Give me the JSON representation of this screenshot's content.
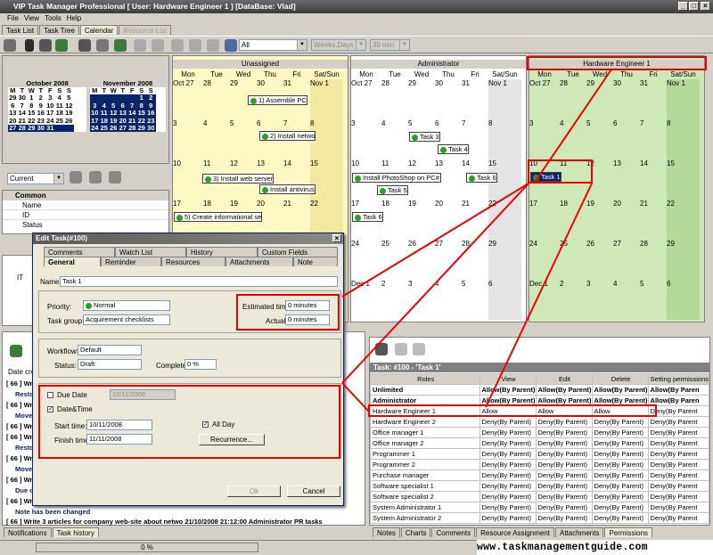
{
  "window": {
    "title": "VIP Task Manager Professional [ User: Hardware Engineer 1 ] [DataBase: Vlad]"
  },
  "menu": [
    "File",
    "View",
    "Tools",
    "Help"
  ],
  "view_tabs": [
    "Task List",
    "Task Tree",
    "Calendar",
    "Resource List"
  ],
  "toolbar": {
    "filter_value": "All",
    "view_mode": "Weeks,Days",
    "interval": "30 min"
  },
  "mini_calendar": {
    "oct": {
      "title": "October 2008",
      "weekdays": [
        "M",
        "T",
        "W",
        "T",
        "F",
        "S",
        "S"
      ],
      "rows": [
        [
          "29",
          "30",
          "1",
          "2",
          "3",
          "4",
          "5"
        ],
        [
          "6",
          "7",
          "8",
          "9",
          "10",
          "11",
          "12"
        ],
        [
          "13",
          "14",
          "15",
          "16",
          "17",
          "18",
          "19"
        ],
        [
          "20",
          "21",
          "22",
          "23",
          "24",
          "25",
          "26"
        ],
        [
          "27",
          "28",
          "29",
          "30",
          "31",
          "",
          ""
        ]
      ],
      "weeknums": [
        "40",
        "41",
        "42",
        "43",
        "44"
      ]
    },
    "nov": {
      "title": "November 2008",
      "weekdays": [
        "M",
        "T",
        "W",
        "T",
        "F",
        "S",
        "S"
      ],
      "rows": [
        [
          "",
          "",
          "",
          "",
          "",
          "1",
          "2"
        ],
        [
          "3",
          "4",
          "5",
          "6",
          "7",
          "8",
          "9"
        ],
        [
          "10",
          "11",
          "12",
          "13",
          "14",
          "15",
          "16"
        ],
        [
          "17",
          "18",
          "19",
          "20",
          "21",
          "22",
          "23"
        ],
        [
          "24",
          "25",
          "26",
          "27",
          "28",
          "29",
          "30"
        ]
      ],
      "weeknums": [
        "44",
        "45",
        "46",
        "47",
        "48"
      ]
    }
  },
  "filter_combo": "Current",
  "properties": {
    "section": "Common",
    "rows": [
      "Name",
      "ID",
      "Status"
    ]
  },
  "calendars": [
    {
      "header": "Unassigned",
      "days": [
        "Mon",
        "Tue",
        "Wed",
        "Thu",
        "Fri",
        "Sat/Sun"
      ],
      "weeks": [
        [
          "Oct 27",
          "28",
          "29",
          "30",
          "31",
          "Nov 1"
        ],
        [
          "3",
          "4",
          "5",
          "6",
          "7",
          "8"
        ],
        [
          "10",
          "11",
          "12",
          "13",
          "14",
          "15"
        ],
        [
          "17",
          "18",
          "19",
          "20",
          "21",
          "22"
        ]
      ],
      "appts": [
        "1) Assemble PC",
        "2) Install netwo",
        "3) Install web server",
        "Install antivirus",
        "5) Create informational se"
      ]
    },
    {
      "header": "Administrator",
      "days": [
        "Mon",
        "Tue",
        "Wed",
        "Thu",
        "Fri",
        "Sat/Sun"
      ],
      "weeks": [
        [
          "Oct 27",
          "28",
          "29",
          "30",
          "31",
          "Nov 1"
        ],
        [
          "3",
          "4",
          "5",
          "6",
          "7",
          "8"
        ],
        [
          "10",
          "11",
          "12",
          "13",
          "14",
          "15"
        ],
        [
          "17",
          "18",
          "19",
          "20",
          "21",
          "22"
        ],
        [
          "24",
          "25",
          "26",
          "27",
          "28",
          "29"
        ],
        [
          "Dec 1",
          "2",
          "3",
          "4",
          "5",
          "6"
        ]
      ],
      "appts": [
        "Task 3",
        "Task 4",
        "Install PhotoShop on PC# 12",
        "Task 5",
        "Task 6",
        "Task 6"
      ]
    },
    {
      "header": "Hardware Engineer 1",
      "days": [
        "Mon",
        "Tue",
        "Wed",
        "Thu",
        "Fri",
        "Sat/Sun"
      ],
      "weeks": [
        [
          "Oct 27",
          "28",
          "29",
          "30",
          "31",
          "Nov 1"
        ],
        [
          "3",
          "4",
          "5",
          "6",
          "7",
          "8"
        ],
        [
          "10",
          "11",
          "12",
          "13",
          "14",
          "15"
        ],
        [
          "17",
          "18",
          "19",
          "20",
          "21",
          "22"
        ],
        [
          "24",
          "25",
          "26",
          "27",
          "28",
          "29"
        ],
        [
          "Dec 1",
          "2",
          "3",
          "4",
          "5",
          "6"
        ]
      ],
      "appts": [
        "Task 1"
      ]
    }
  ],
  "dialog": {
    "title": "Edit Task(#100)",
    "tabs_row1": [
      "Comments",
      "Watch List",
      "History",
      "Custom Fields"
    ],
    "tabs_row2": [
      "General",
      "Reminder",
      "Resources",
      "Attachments",
      "Note"
    ],
    "name_label": "Name:",
    "name_value": "Task 1",
    "priority_label": "Priority:",
    "priority_value": "Normal",
    "group_label": "Task group:",
    "group_value": "Acquirement checklists",
    "est_label": "Estimated time:",
    "est_value": "0 minutes",
    "actual_label": "Actual time:",
    "actual_value": "0 minutes",
    "workflow_label": "Workflow:",
    "workflow_value": "Default",
    "status_label": "Status:",
    "status_value": "Draft",
    "complete_label": "Complete:",
    "complete_value": "0 %",
    "due_label": "Due Date",
    "due_value": "10/11/2008",
    "datetime_label": "Date&Time",
    "start_label": "Start time:",
    "start_value": "10/11/2008",
    "finish_label": "Finish time:",
    "finish_value": "11/11/2008",
    "allday_label": "All Day",
    "recurrence_label": "Recurrence...",
    "ok_label": "Ok",
    "cancel_label": "Cancel"
  },
  "tree_item": "IT",
  "history": {
    "date_label": "Date cre",
    "lines": [
      "[ 66 ] Wr",
      "Resto",
      "[ 66 ] Wr",
      "Move",
      "[ 66 ] Wr",
      "[ 66 ] Wr",
      "Resto",
      "[ 66 ] Wr",
      "Move",
      "[ 66 ] Wr",
      "Due d",
      "[ 66 ] Wr"
    ],
    "note": "Note has been changed",
    "last": "[ 66 ] Write 3 articles for company web-site about netwo 21/10/2008 21:12:00  Administrator  PR tasks"
  },
  "bottom_tabs_left": [
    "Notifications",
    "Task history"
  ],
  "progress": "0 %",
  "perm": {
    "title": "Task: #100 - 'Task 1'",
    "headers": [
      "Roles",
      "View",
      "Edit",
      "Delete",
      "Setting permissions"
    ],
    "rows": [
      [
        "Unlimited",
        "Allow(By Parent)",
        "Allow(By Parent)",
        "Allow(By Parent)",
        "Allow(By Paren"
      ],
      [
        "Administrator",
        "Allow(By Parent)",
        "Allow(By Parent)",
        "Allow(By Parent)",
        "Allow(By Paren"
      ],
      [
        "Hardware Engineer 1",
        "Allow",
        "Allow",
        "Allow",
        "Deny(By Parent"
      ],
      [
        "Hardware Engineer 2",
        "Deny(By Parent)",
        "Deny(By Parent)",
        "Deny(By Parent)",
        "Deny(By Parent"
      ],
      [
        "Office manager 1",
        "Deny(By Parent)",
        "Deny(By Parent)",
        "Deny(By Parent)",
        "Deny(By Parent"
      ],
      [
        "Office manager 2",
        "Deny(By Parent)",
        "Deny(By Parent)",
        "Deny(By Parent)",
        "Deny(By Parent"
      ],
      [
        "Programmer 1",
        "Deny(By Parent)",
        "Deny(By Parent)",
        "Deny(By Parent)",
        "Deny(By Parent"
      ],
      [
        "Programmer 2",
        "Deny(By Parent)",
        "Deny(By Parent)",
        "Deny(By Parent)",
        "Deny(By Parent"
      ],
      [
        "Purchase manager",
        "Deny(By Parent)",
        "Deny(By Parent)",
        "Deny(By Parent)",
        "Deny(By Parent"
      ],
      [
        "Software specialist 1",
        "Deny(By Parent)",
        "Deny(By Parent)",
        "Deny(By Parent)",
        "Deny(By Parent"
      ],
      [
        "Software specialist 2",
        "Deny(By Parent)",
        "Deny(By Parent)",
        "Deny(By Parent)",
        "Deny(By Parent"
      ],
      [
        "System Administrator 1",
        "Deny(By Parent)",
        "Deny(By Parent)",
        "Deny(By Parent)",
        "Deny(By Parent"
      ],
      [
        "System Administrator 2",
        "Deny(By Parent)",
        "Deny(By Parent)",
        "Deny(By Parent)",
        "Deny(By Parent"
      ]
    ]
  },
  "bottom_tabs_right": [
    "Notes",
    "Charts",
    "Comments",
    "Resource Assignment",
    "Attachments",
    "Permissions"
  ],
  "watermark": "www.taskmanagementguide.com",
  "colors": {
    "selected": "#0a246a",
    "highlight": "#e00000",
    "unassigned_bg": "#fdf7c3",
    "engineer_bg": "#cfe8b8"
  }
}
